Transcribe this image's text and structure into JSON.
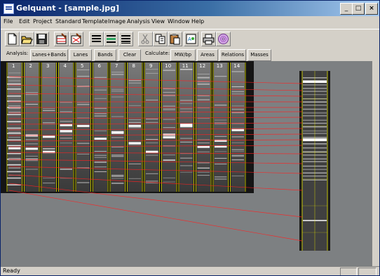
{
  "window": {
    "title": "Gelquant - [sample.jpg]",
    "controls": [
      "_",
      "□",
      "×"
    ]
  },
  "menubar": {
    "items": [
      "File",
      "Edit",
      "Project",
      "Standard",
      "Template",
      "Image",
      "Analysis",
      "View",
      "Window",
      "Help"
    ]
  },
  "toolbar": {
    "icons": [
      "new-icon",
      "open-icon",
      "save-icon",
      "edit-lanes-icon",
      "edit-bands-icon",
      "align-left-icon",
      "align-center-icon",
      "align-right-icon",
      "cut-icon",
      "copy-icon",
      "paste-icon",
      "zoom-icon",
      "print-icon",
      "cd-icon"
    ]
  },
  "analysis_bar": {
    "analysis_label": "Analysis:",
    "lanes_bands_label": "Lanes+Bands",
    "lanes_label": "Lanes",
    "bands_label": "Bands",
    "clear_label": "Clear",
    "calculate_label": "Calculate:",
    "mwbp_label": "MW/bp",
    "areas_label": "Areas",
    "relations_label": "Relations",
    "masses_label": "Masses"
  },
  "gel": {
    "lane_labels": [
      "1",
      "2",
      "3",
      "4",
      "5",
      "6",
      "7",
      "8",
      "9",
      "10",
      "11",
      "12",
      "13",
      "14"
    ]
  },
  "colors": {
    "title_start": "#0a246a",
    "title_end": "#a6caf0",
    "workspace": "#7d8082",
    "lane_marker": "#e6e600",
    "relation_line": "#ff2020"
  },
  "status": {
    "text": "Ready"
  }
}
